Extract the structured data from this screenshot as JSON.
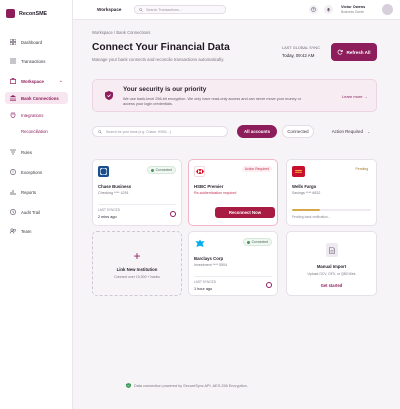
{
  "brand": {
    "name": "ReconSME",
    "color": "#8e1d5c"
  },
  "nav": {
    "items": [
      {
        "label": "Dashboard",
        "icon": "grid-icon"
      },
      {
        "label": "Transactions",
        "icon": "list-icon"
      },
      {
        "label": "Workspace",
        "icon": "briefcase-icon"
      },
      {
        "label": "Bank Connections",
        "icon": "bank-icon"
      },
      {
        "label": "Integrations",
        "icon": "plug-icon"
      },
      {
        "label": "Reconciliation",
        "icon": "sync-icon"
      },
      {
        "label": "Rules",
        "icon": "rules-icon"
      },
      {
        "label": "Exceptions",
        "icon": "alert-icon"
      },
      {
        "label": "Reports",
        "icon": "chart-icon"
      },
      {
        "label": "Audit Trail",
        "icon": "clock-icon"
      },
      {
        "label": "Team",
        "icon": "users-icon"
      }
    ]
  },
  "topbar": {
    "workspace": "Workspace",
    "search_placeholder": "Search Transactions...",
    "user_name": "Victor Owens",
    "user_role": "Business Owner"
  },
  "page": {
    "breadcrumb": "Workspace / Bank Connections",
    "title": "Connect Your Financial Data",
    "subtitle": "Manage your bank connects and reconcile transactions automatically.",
    "sync_label": "LAST GLOBAL SYNC",
    "sync_time": "Today, 09:42 AM",
    "refresh_label": "Refresh All"
  },
  "security": {
    "title": "Your security is our priority",
    "text": "We use bank-level 256-bit encryption. We only have read-only access and can never move your money or access your login credentials.",
    "link": "Learn more →"
  },
  "filters": {
    "search_placeholder": "Search for your bank (e.g. Chase, HSBC...)",
    "all": "All accounts",
    "connected": "Connected",
    "action": "Action Required"
  },
  "cards": {
    "chase": {
      "name": "Chase Business",
      "account": "Checking **** 4291",
      "status": "Connected",
      "sync_label": "LAST SYNCED",
      "sync_value": "2 mins ago"
    },
    "hsbc": {
      "name": "HSBC Premier",
      "error": "Re-authentication required",
      "status": "Action Required",
      "button": "Reconnect Now"
    },
    "wells": {
      "name": "Wells Fargo",
      "account": "Savings **** 6632",
      "status": "Pending",
      "note": "Pending bank verification…",
      "progress": 0.35
    },
    "link_new": {
      "title": "Link New Institution",
      "subtitle": "Connect over 10,000 + banks"
    },
    "barclays": {
      "name": "Barclays Corp",
      "account": "Investment **** 5504",
      "status": "Connected",
      "sync_label": "LAST SYNCED",
      "sync_value": "1 hour ago"
    },
    "manual": {
      "title": "Manual Import",
      "subtitle": "Upload OCV, OFX, or QBO files",
      "link": "Get started"
    }
  },
  "footer": {
    "note": "Data connection powered by SecureSync API. AES-256 Encryption."
  }
}
